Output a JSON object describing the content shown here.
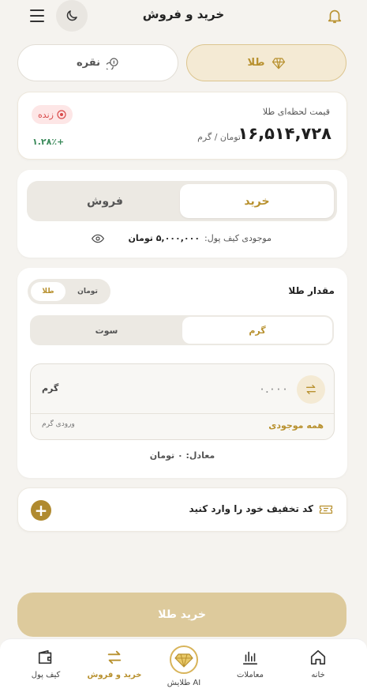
{
  "header": {
    "title": "خرید و فروش"
  },
  "metal_tabs": {
    "gold": "طلا",
    "silver": "نقره"
  },
  "price_card": {
    "label": "قیمت لحظه‌ای طلا",
    "price": "۱۶,۵۱۴,۷۲۸",
    "unit": "تومان / گرم",
    "live": "زنده",
    "change": "۱.۲۸٪+"
  },
  "trade": {
    "buy": "خرید",
    "sell": "فروش",
    "wallet_label": "موجودی کیف پول:",
    "wallet_value": "۵,۰۰۰,۰۰۰ تومان"
  },
  "amount": {
    "title": "مقدار طلا",
    "toggle_gold": "طلا",
    "toggle_toman": "تومان",
    "gram": "گرم",
    "sout": "سوت",
    "input_value": "۰.۰۰۰",
    "input_unit": "گرم",
    "all_balance": "همه موجودی",
    "input_hint": "ورودی گرم",
    "equivalent": "معادل: ۰ تومان"
  },
  "coupon": {
    "text": "کد تخفیف خود را وارد کنید"
  },
  "submit": {
    "label": "خرید طلا"
  },
  "nav": {
    "home": "خانه",
    "transactions": "معاملات",
    "ai": "طلایش AI",
    "trade": "خرید و فروش",
    "wallet": "کیف پول"
  },
  "colors": {
    "accent": "#b8912f",
    "accent_light": "#f4ead4",
    "live": "#d94a4a",
    "positive": "#3a8a5a"
  }
}
